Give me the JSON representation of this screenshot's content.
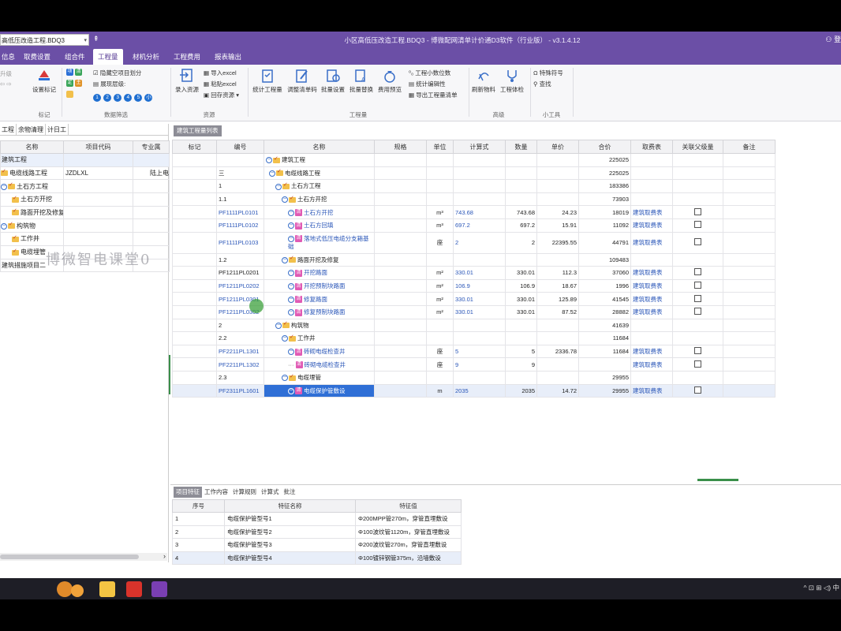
{
  "titlebar": {
    "file_select": "高低压改造工程.BDQ3",
    "qa_icon": "⇞",
    "title": "小区高低压改造工程.BDQ3 - 博微配网清单计价通D3软件（行业版） - v3.1.4.12",
    "user_icon": "user-icon",
    "user_text": "登"
  },
  "menu": [
    "信息",
    "取费设置",
    "组合件",
    "工程量",
    "材机分析",
    "工程费用",
    "报表输出"
  ],
  "menu_active": "工程量",
  "ribbon": {
    "undo": "升级",
    "set_mark": "设置标记",
    "group_mark": "标记",
    "filter_items": [
      "项",
      "清",
      "定",
      "主"
    ],
    "hide_empty": "隐藏空项目划分",
    "expand_level": "展现层级:",
    "levels": [
      "1",
      "2",
      "3",
      "4",
      "5",
      "小"
    ],
    "group_filter": "数据筛选",
    "import_resource": "录入资源",
    "import_excel": "导入excel",
    "paste_excel": "粘贴excel",
    "write_back": "回存资源",
    "group_resource": "资源",
    "btns": [
      "统计工程量",
      "调整清单码",
      "批量设置",
      "批量替换",
      "费用预览"
    ],
    "small_btns": [
      "工程小数位数",
      "统计编辑性",
      "导出工程量清单"
    ],
    "group_quantity": "工程量",
    "refresh_material": "刷新物料",
    "engineering_check": "工程体检",
    "group_advanced": "高级",
    "special_symbol": "特殊符号",
    "search": "查找",
    "group_tools": "小工具"
  },
  "left": {
    "tabs": [
      "工程",
      "余物清理",
      "计日工"
    ],
    "columns": [
      "名称",
      "项目代码",
      "专业属"
    ],
    "rows": [
      {
        "name": "建筑工程",
        "code": "",
        "spec": ""
      },
      {
        "name": "电缆线路工程",
        "code": "JZDLXL",
        "spec": "陆上电"
      },
      {
        "name": "土石方工程",
        "code": "",
        "spec": ""
      },
      {
        "name": "土石方开挖",
        "code": "",
        "spec": ""
      },
      {
        "name": "路面开挖及修复",
        "code": "",
        "spec": ""
      },
      {
        "name": "构筑物",
        "code": "",
        "spec": ""
      },
      {
        "name": "工作井",
        "code": "",
        "spec": ""
      },
      {
        "name": "电缆埋管",
        "code": "",
        "spec": ""
      },
      {
        "name": "建筑措施项目二",
        "code": "",
        "spec": ""
      }
    ],
    "watermark": "博微智电课堂0"
  },
  "main": {
    "tab": "建筑工程量列表",
    "columns": [
      "标记",
      "编号",
      "名称",
      "规格",
      "单位",
      "计算式",
      "数量",
      "单价",
      "合价",
      "取费表",
      "关联父级量",
      "备注"
    ],
    "rows": [
      {
        "code": "",
        "name": "建筑工程",
        "unit": "",
        "formula": "",
        "qty": "",
        "price": "",
        "total": "225025",
        "fee": ""
      },
      {
        "code": "三",
        "name": "电缆线路工程",
        "unit": "",
        "formula": "",
        "qty": "",
        "price": "",
        "total": "225025",
        "fee": ""
      },
      {
        "code": "1",
        "name": "土石方工程",
        "unit": "",
        "formula": "",
        "qty": "",
        "price": "",
        "total": "183386",
        "fee": ""
      },
      {
        "code": "1.1",
        "name": "土石方开挖",
        "unit": "",
        "formula": "",
        "qty": "",
        "price": "",
        "total": "73903",
        "fee": ""
      },
      {
        "code": "PF1111PL0101",
        "name": "土石方开挖",
        "unit": "m³",
        "formula": "743.68",
        "qty": "743.68",
        "price": "24.23",
        "total": "18019",
        "fee": "建筑取费表"
      },
      {
        "code": "PF1111PL0102",
        "name": "土石方回填",
        "unit": "m³",
        "formula": "697.2",
        "qty": "697.2",
        "price": "15.91",
        "total": "11092",
        "fee": "建筑取费表"
      },
      {
        "code": "PF1111PL0103",
        "name": "落地式低压电缆分支箱基础",
        "unit": "座",
        "formula": "2",
        "qty": "2",
        "price": "22395.55",
        "total": "44791",
        "fee": "建筑取费表"
      },
      {
        "code": "1.2",
        "name": "路面开挖及修复",
        "unit": "",
        "formula": "",
        "qty": "",
        "price": "",
        "total": "109483",
        "fee": ""
      },
      {
        "code": "PF1211PL0201",
        "name": "开挖路面",
        "unit": "m²",
        "formula": "330.01",
        "qty": "330.01",
        "price": "112.3",
        "total": "37060",
        "fee": "建筑取费表"
      },
      {
        "code": "PF1211PL0202",
        "name": "开挖预制块路面",
        "unit": "m²",
        "formula": "106.9",
        "qty": "106.9",
        "price": "18.67",
        "total": "1996",
        "fee": "建筑取费表"
      },
      {
        "code": "PF1211PL0301",
        "name": "修复路面",
        "unit": "m²",
        "formula": "330.01",
        "qty": "330.01",
        "price": "125.89",
        "total": "41545",
        "fee": "建筑取费表"
      },
      {
        "code": "PF1211PL0302",
        "name": "修复预制块路面",
        "unit": "m²",
        "formula": "330.01",
        "qty": "330.01",
        "price": "87.52",
        "total": "28882",
        "fee": "建筑取费表"
      },
      {
        "code": "2",
        "name": "构筑物",
        "unit": "",
        "formula": "",
        "qty": "",
        "price": "",
        "total": "41639",
        "fee": ""
      },
      {
        "code": "2.2",
        "name": "工作井",
        "unit": "",
        "formula": "",
        "qty": "",
        "price": "",
        "total": "11684",
        "fee": ""
      },
      {
        "code": "PF2211PL1301",
        "name": "砖砌电缆检查井",
        "unit": "座",
        "formula": "5",
        "qty": "5",
        "price": "2336.78",
        "total": "11684",
        "fee": "建筑取费表"
      },
      {
        "code": "PF2211PL1302",
        "name": "砖砌电缆检查井",
        "unit": "座",
        "formula": "9",
        "qty": "9",
        "price": "",
        "total": "",
        "fee": "建筑取费表"
      },
      {
        "code": "2.3",
        "name": "电缆埋管",
        "unit": "",
        "formula": "",
        "qty": "",
        "price": "",
        "total": "29955",
        "fee": ""
      },
      {
        "code": "PF2311PL1601",
        "name": "电缆保护管敷设",
        "unit": "m",
        "formula": "2035",
        "qty": "2035",
        "price": "14.72",
        "total": "29955",
        "fee": "建筑取费表"
      }
    ]
  },
  "bottom": {
    "tabs": [
      "项目特征",
      "工作内容",
      "计算规则",
      "计算式",
      "批注"
    ],
    "columns": [
      "序号",
      "特征名称",
      "特征值"
    ],
    "rows": [
      {
        "no": "1",
        "name": "电缆保护管型号1",
        "value": "Φ200MPP管270m，穿管直埋敷设"
      },
      {
        "no": "2",
        "name": "电缆保护管型号2",
        "value": "Φ100波纹管1120m，穿管直埋敷设"
      },
      {
        "no": "3",
        "name": "电缆保护管型号3",
        "value": "Φ200波纹管270m，穿管直埋敷设"
      },
      {
        "no": "4",
        "name": "电缆保护管型号4",
        "value": "Φ100镀锌钢管375m，沿墙敷设"
      }
    ]
  },
  "taskbar": {
    "tray": "^ ⊡ ⊞ ◁) 中"
  }
}
